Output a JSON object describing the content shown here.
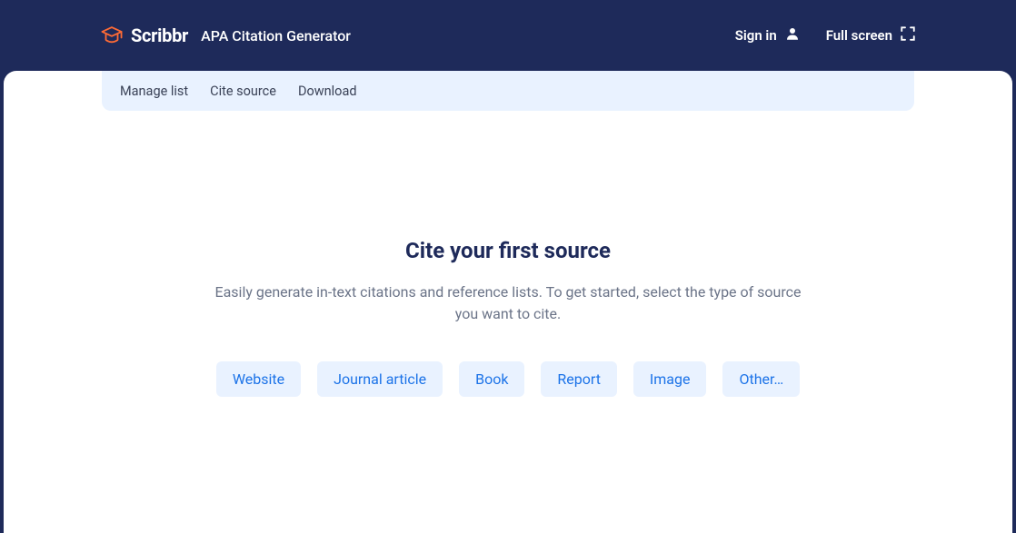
{
  "header": {
    "logo_text": "Scribbr",
    "app_title": "APA Citation Generator",
    "sign_in_label": "Sign in",
    "fullscreen_label": "Full screen"
  },
  "tabs": {
    "manage_list": "Manage list",
    "cite_source": "Cite source",
    "download": "Download"
  },
  "main": {
    "heading": "Cite your first source",
    "description": "Easily generate in-text citations and reference lists. To get started, select the type of source you want to cite."
  },
  "source_types": {
    "website": "Website",
    "journal_article": "Journal article",
    "book": "Book",
    "report": "Report",
    "image": "Image",
    "other": "Other…"
  }
}
